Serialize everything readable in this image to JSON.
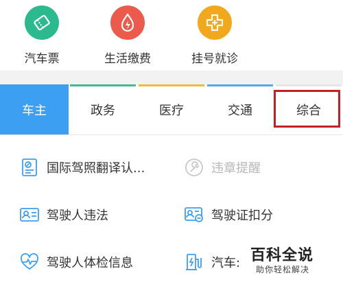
{
  "shortcuts": [
    {
      "label": "汽车票",
      "icon": "ticket-icon",
      "color": "#2bb98e"
    },
    {
      "label": "生活缴费",
      "icon": "utility-drop-icon",
      "color": "#ec5a4c"
    },
    {
      "label": "挂号就诊",
      "icon": "medical-cross-icon",
      "color": "#f2a81c"
    }
  ],
  "tabs": [
    {
      "label": "车主",
      "active": true
    },
    {
      "label": "政务"
    },
    {
      "label": "医疗"
    },
    {
      "label": "交通"
    },
    {
      "label": "综合",
      "highlighted": true
    }
  ],
  "items": [
    {
      "label": "国际驾照翻译认...",
      "icon": "license-doc-icon"
    },
    {
      "label": "违章提醒",
      "icon": "wrench-icon",
      "disabled": true
    },
    {
      "label": "驾驶人违法",
      "icon": "driver-id-card-icon"
    },
    {
      "label": "驾驶证扣分",
      "icon": "license-minus-icon"
    },
    {
      "label": "驾驶人体检信息",
      "icon": "heartbeat-icon"
    },
    {
      "label": "汽车:",
      "icon": "charging-station-icon"
    }
  ],
  "watermark": {
    "title": "百科全说",
    "subtitle": "助你轻松解决"
  },
  "colors": {
    "active_tab": "#3d9ff2",
    "highlight_box": "#c51f26",
    "icon_blue": "#3d9ff2"
  }
}
